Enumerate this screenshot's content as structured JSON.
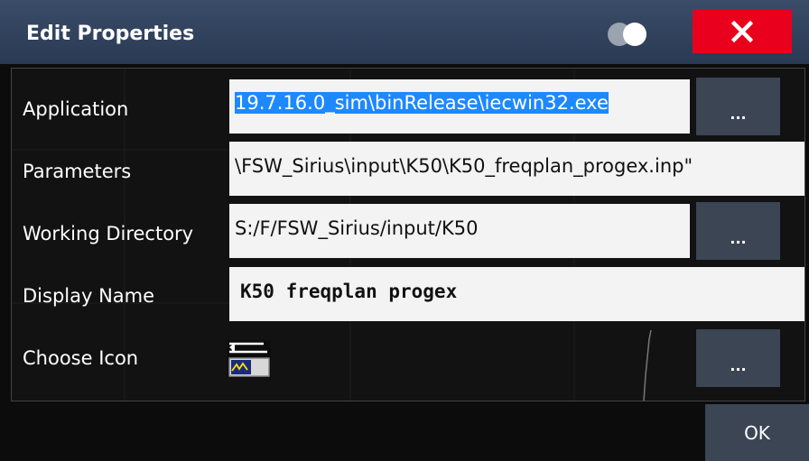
{
  "title": "Edit Properties",
  "icons": {
    "close": "close-x-icon",
    "toggle": "toggle-circles-icon",
    "chosen": "application-trace-icon"
  },
  "colors": {
    "titlebar": "#34465f",
    "close": "#e8001c",
    "selection": "#1e88ff",
    "button": "#3c4554"
  },
  "fields": {
    "application": {
      "label": "Application",
      "value": "19.7.16.0_sim\\binRelease\\iecwin32.exe",
      "browse": "..."
    },
    "parameters": {
      "label": "Parameters",
      "value": "\\FSW_Sirius\\input\\K50\\K50_freqplan_progex.inp\""
    },
    "working_directory": {
      "label": "Working Directory",
      "value": "S:/F/FSW_Sirius/input/K50",
      "browse": "..."
    },
    "display_name": {
      "label": "Display Name",
      "value": "K50 freqplan progex"
    },
    "choose_icon": {
      "label": "Choose Icon",
      "browse": "..."
    }
  },
  "ok_label": "OK"
}
